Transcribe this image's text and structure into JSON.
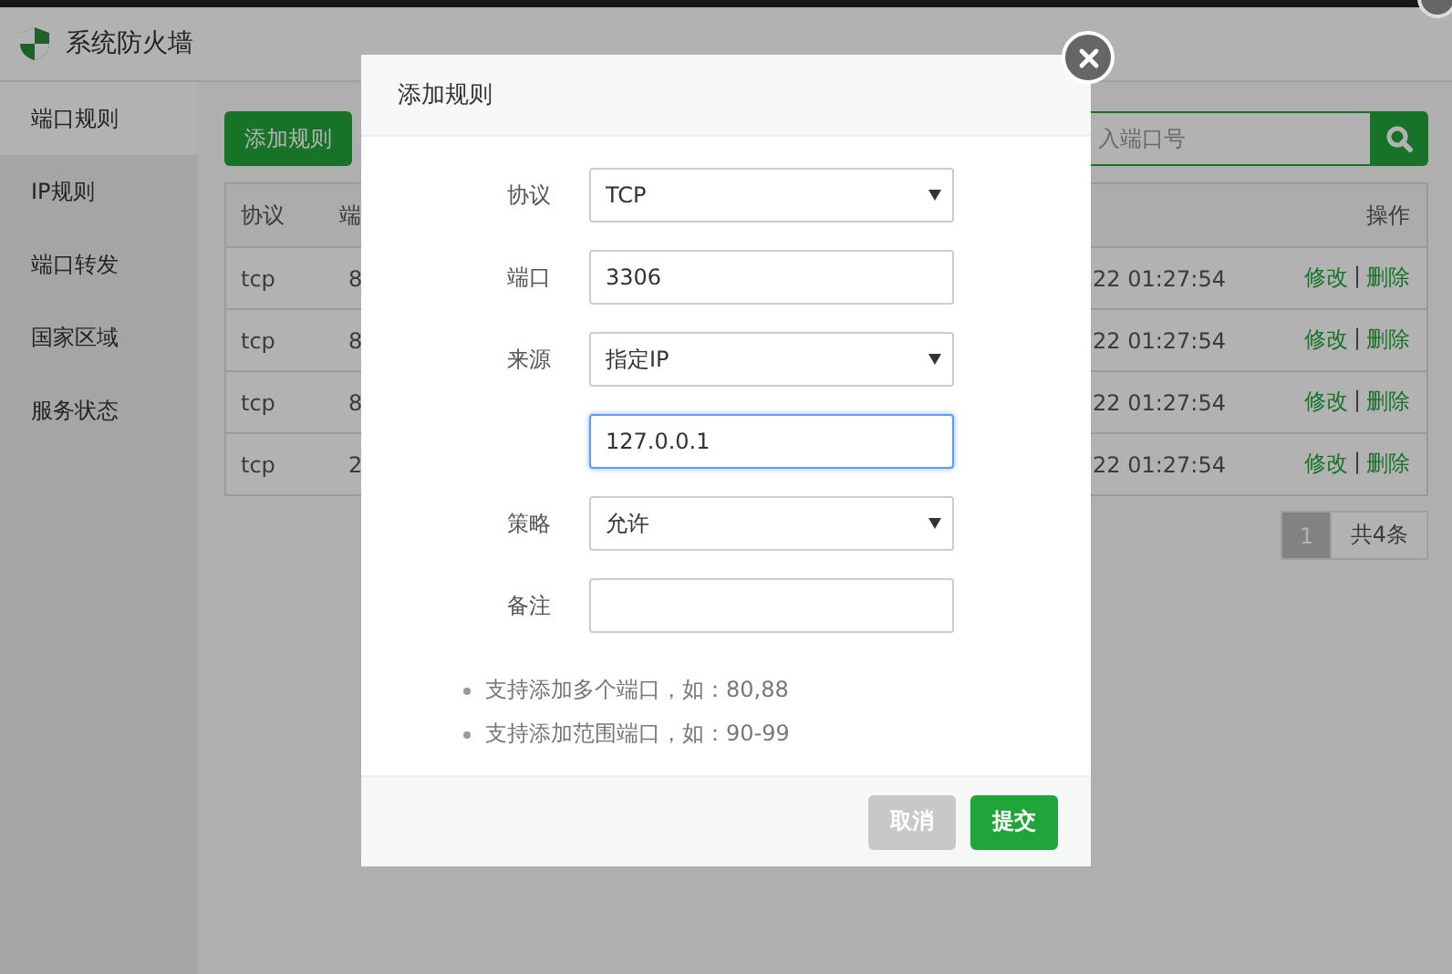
{
  "window": {
    "title": "系统防火墙"
  },
  "sidebar": {
    "items": [
      {
        "label": "端口规则",
        "selected": true
      },
      {
        "label": "IP规则",
        "selected": false
      },
      {
        "label": "端口转发",
        "selected": false
      },
      {
        "label": "国家区域",
        "selected": false
      },
      {
        "label": "服务状态",
        "selected": false
      }
    ]
  },
  "toolbar": {
    "add_button": "添加规则",
    "search": {
      "placeholder": "入端口号"
    }
  },
  "table": {
    "columns": [
      "协议",
      "端",
      "操作"
    ],
    "action_separator": "|",
    "rows": [
      {
        "protocol": "tcp",
        "port": "8",
        "time": "22 01:27:54",
        "actions": [
          "修改",
          "删除"
        ]
      },
      {
        "protocol": "tcp",
        "port": "8",
        "time": "22 01:27:54",
        "actions": [
          "修改",
          "删除"
        ]
      },
      {
        "protocol": "tcp",
        "port": "8",
        "time": "22 01:27:54",
        "actions": [
          "修改",
          "删除"
        ]
      },
      {
        "protocol": "tcp",
        "port": "2",
        "time": "22 01:27:54",
        "actions": [
          "修改",
          "删除"
        ]
      }
    ]
  },
  "pagination": {
    "pages": [
      {
        "label": "1",
        "selected": true
      }
    ],
    "total": "共4条"
  },
  "dialog": {
    "title": "添加规则",
    "fields": [
      {
        "label": "协议",
        "kind": "select",
        "value": "TCP",
        "focused": false
      },
      {
        "label": "端口",
        "kind": "input",
        "value": "3306",
        "focused": false
      },
      {
        "label": "来源",
        "kind": "select",
        "value": "指定IP",
        "focused": false
      },
      {
        "kind": "input",
        "value": "127.0.0.1",
        "focused": true
      },
      {
        "label": "策略",
        "kind": "select",
        "value": "允许",
        "focused": false
      },
      {
        "label": "备注",
        "kind": "input",
        "focused": false
      }
    ],
    "notes": [
      "支持添加多个端口，如：80,88",
      "支持添加范围端口，如：90-99"
    ],
    "buttons": [
      {
        "label": "取消",
        "kind": "cancel"
      },
      {
        "label": "提交",
        "kind": "primary"
      }
    ]
  }
}
